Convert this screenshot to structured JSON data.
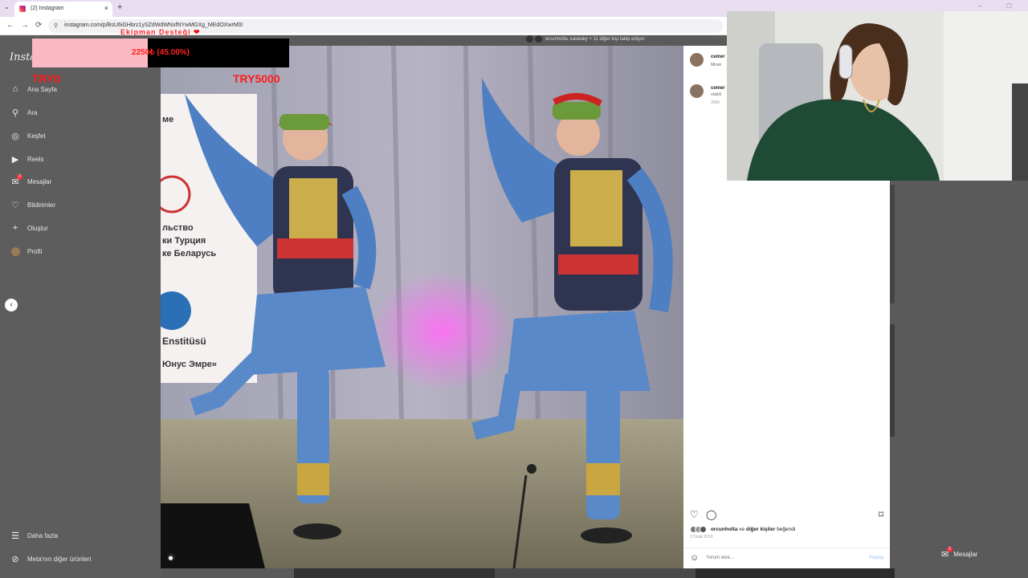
{
  "browser": {
    "tab_title": "(2) Instagram",
    "url": "instagram.com/p/BsU6iGHbrz1ySZdWdWNxfNYwMGXg_MEdOXwrM0/",
    "tab_close": "×",
    "new_tab": "+",
    "tab_menu": "⌄",
    "window_controls": "– ☐",
    "nav": {
      "back": "←",
      "forward": "→",
      "reload": "⟳",
      "site_info": "⚲"
    }
  },
  "overlay": {
    "title": "Ekipman Desteği",
    "heart": "❤",
    "progress_text": "2250₺ (45.00%)",
    "progress_fraction": 0.45,
    "left_label": "TRY0",
    "right_label": "TRY5000",
    "progress_fill_color": "#f9b8c2",
    "text_color": "#ff2020"
  },
  "sidebar": {
    "logo": "Insta",
    "items": [
      {
        "label": "Ana Sayfa",
        "icon": "home-icon",
        "glyph": "⌂"
      },
      {
        "label": "Ara",
        "icon": "search-icon",
        "glyph": "⚲"
      },
      {
        "label": "Keşfet",
        "icon": "compass-icon",
        "glyph": "◎"
      },
      {
        "label": "Reels",
        "icon": "reels-icon",
        "glyph": "▶"
      },
      {
        "label": "Mesajlar",
        "icon": "messenger-icon",
        "glyph": "✉",
        "badge": "2"
      },
      {
        "label": "Bildirimler",
        "icon": "heart-icon",
        "glyph": "♡"
      },
      {
        "label": "Oluştur",
        "icon": "plus-icon",
        "glyph": "+"
      },
      {
        "label": "Profil",
        "icon": "avatar",
        "glyph": ""
      }
    ],
    "more": {
      "label": "Daha fazla",
      "glyph": "☰"
    },
    "meta": {
      "label": "Meta'nın diğer ürünleri",
      "glyph": "⊘"
    },
    "back_glyph": "‹"
  },
  "post": {
    "top_strip": "orcunholta, kalalaky + 11 diğer kişi takip ediyor",
    "comments": [
      {
        "user": "cemer",
        "sub": "Minsk",
        "time": ""
      },
      {
        "user": "cemer",
        "sub": "olabili",
        "time": "359h"
      }
    ],
    "actions": {
      "like": "♡",
      "comment": "◯",
      "save": "⌑"
    },
    "liked_by_user": "orcunholta",
    "liked_by_rest": " ve ",
    "liked_by_others": "diğer kişiler",
    "liked_by_suffix": " beğendi",
    "date": "2 Ocak 2019",
    "comment_placeholder": "Yorum ekle...",
    "share_label": "Paylaş",
    "emoji_glyph": "☺",
    "photo_user_glyph": "●",
    "banner_lines": [
      "ме",
      "льство",
      "ки Турция",
      "ке Беларусь",
      "Enstitüsü",
      "Юнус Эмре»"
    ]
  },
  "messages_bar": {
    "label": "Mesajlar",
    "badge": "2",
    "glyph": "✉",
    "trailing": "⠿"
  }
}
